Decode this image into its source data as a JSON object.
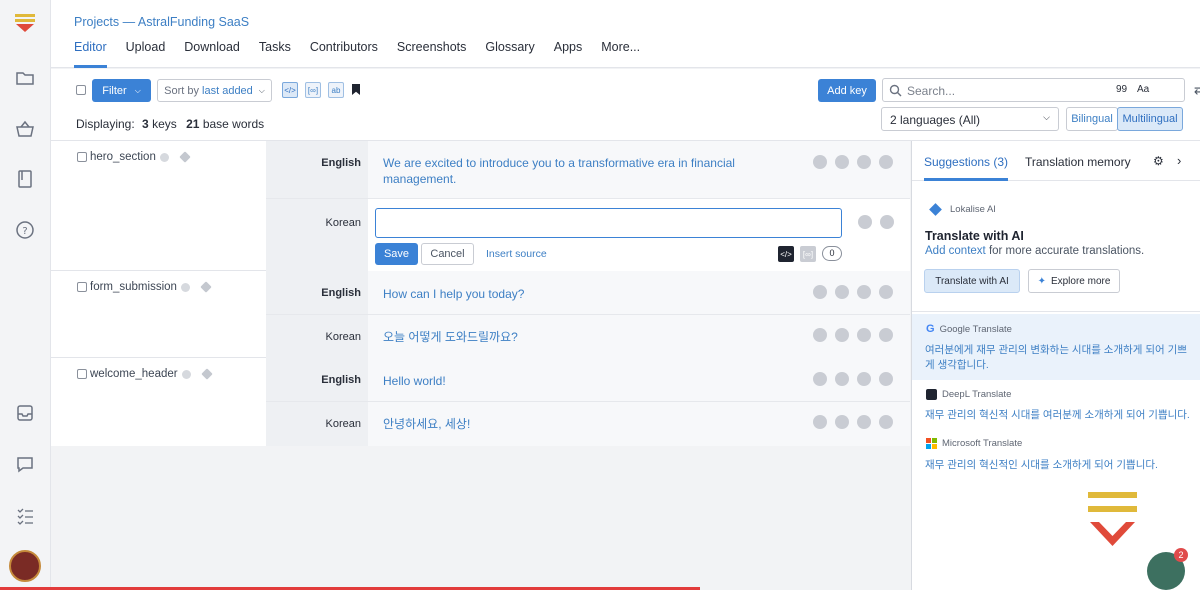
{
  "header": {
    "breadcrumb": "Projects — AstralFunding SaaS",
    "nav": [
      "Editor",
      "Upload",
      "Download",
      "Tasks",
      "Contributors",
      "Screenshots",
      "Glossary",
      "Apps",
      "More..."
    ]
  },
  "toolbar": {
    "filter_label": "Filter",
    "sort_prefix": "Sort by",
    "sort_value": "last added",
    "add_key_label": "Add key",
    "search_placeholder": "Search...",
    "search_count": "99",
    "case_toggle": "Aa",
    "displaying_label": "Displaying:",
    "keys_count": "3",
    "keys_label": "keys",
    "base_words_count": "21",
    "base_words_label": "base words",
    "languages_select": "2 languages (All)",
    "bilingual_label": "Bilingual",
    "multilingual_label": "Multilingual"
  },
  "keys": [
    {
      "name": "hero_section",
      "english_label": "English",
      "english_text": "We are excited to introduce you to a transformative era in financial management.",
      "korean_label": "Korean",
      "save_label": "Save",
      "cancel_label": "Cancel",
      "insert_source_label": "Insert source",
      "char_count": "0"
    },
    {
      "name": "form_submission",
      "english_label": "English",
      "english_text": "How can I help you today?",
      "korean_label": "Korean",
      "korean_text": "오늘 어떻게 도와드릴까요?"
    },
    {
      "name": "welcome_header",
      "english_label": "English",
      "english_text": "Hello world!",
      "korean_label": "Korean",
      "korean_text": "안녕하세요, 세상!"
    }
  ],
  "panel": {
    "tab_suggestions": "Suggestions (3)",
    "tab_memory": "Translation memory",
    "lokalise_ai_label": "Lokalise AI",
    "ai_title": "Translate with AI",
    "add_context_link": "Add context",
    "add_context_rest": "for more accurate translations.",
    "translate_button": "Translate with AI",
    "explore_button": "Explore more",
    "machine_translations": [
      {
        "provider": "Google Translate",
        "text": "여러분에게 재무 관리의 변화하는 시대를 소개하게 되어 기쁘게 생각합니다."
      },
      {
        "provider": "DeepL Translate",
        "text": "재무 관리의 혁신적 시대를 여러분께 소개하게 되어 기쁩니다."
      },
      {
        "provider": "Microsoft Translate",
        "text": "재무 관리의 혁신적인 시대를 소개하게 되어 기쁩니다."
      }
    ]
  },
  "fab": {
    "badge": "2"
  },
  "colors": {
    "accent": "#3b82d6",
    "link": "#3d7fc4"
  }
}
